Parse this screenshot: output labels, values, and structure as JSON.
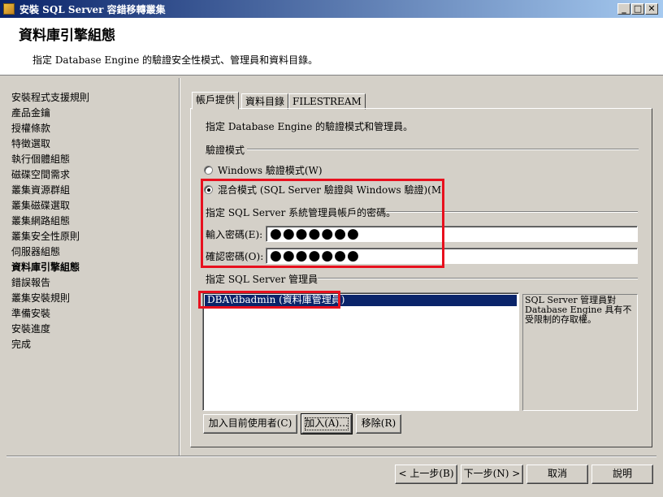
{
  "window": {
    "title": "安裝 SQL Server 容錯移轉叢集",
    "minimize_glyph": "_",
    "maximize_glyph": "□",
    "close_glyph": "✕"
  },
  "header": {
    "title": "資料庫引擎組態",
    "subtitle": "指定 Database Engine 的驗證安全性模式、管理員和資料目錄。"
  },
  "nav": {
    "items": [
      {
        "label": "安裝程式支援規則"
      },
      {
        "label": "產品金鑰"
      },
      {
        "label": "授權條款"
      },
      {
        "label": "特徵選取"
      },
      {
        "label": "執行個體組態"
      },
      {
        "label": "磁碟空間需求"
      },
      {
        "label": "叢集資源群組"
      },
      {
        "label": "叢集磁碟選取"
      },
      {
        "label": "叢集網路組態"
      },
      {
        "label": "叢集安全性原則"
      },
      {
        "label": "伺服器組態"
      },
      {
        "label": "資料庫引擎組態",
        "active": true
      },
      {
        "label": "錯誤報告"
      },
      {
        "label": "叢集安裝規則"
      },
      {
        "label": "準備安裝"
      },
      {
        "label": "安裝進度"
      },
      {
        "label": "完成"
      }
    ]
  },
  "tabs": {
    "account": "帳戶提供",
    "data_dirs": "資料目錄",
    "filestream": "FILESTREAM"
  },
  "account": {
    "intro": "指定 Database Engine 的驗證模式和管理員。",
    "auth_group": "驗證模式",
    "windows_auth": "Windows 驗證模式(W)",
    "mixed_auth": "混合模式 (SQL Server 驗證與 Windows 驗證)(M)",
    "selected_mode": "mixed",
    "sa_group": "指定 SQL Server 系統管理員帳戶的密碼。",
    "password_label": "輸入密碼(E):",
    "password_value": "●●●●●●●",
    "confirm_label": "確認密碼(O):",
    "confirm_value": "●●●●●●●",
    "admins_group": "指定 SQL Server 管理員",
    "admins": [
      "DBA\\dbadmin (資料庫管理員)"
    ],
    "admins_help": "SQL Server 管理員對 Database Engine 具有不受限制的存取權。",
    "add_current_user": "加入目前使用者(C)",
    "add": "加入(A)...",
    "remove": "移除(R)"
  },
  "footer": {
    "back": "< 上一步(B)",
    "next": "下一步(N) >",
    "cancel": "取消",
    "help": "說明"
  },
  "colors": {
    "title_bar": "#0a246a",
    "selection": "#0a246a",
    "highlight_box": "#e8101e",
    "face": "#d4d0c8"
  }
}
